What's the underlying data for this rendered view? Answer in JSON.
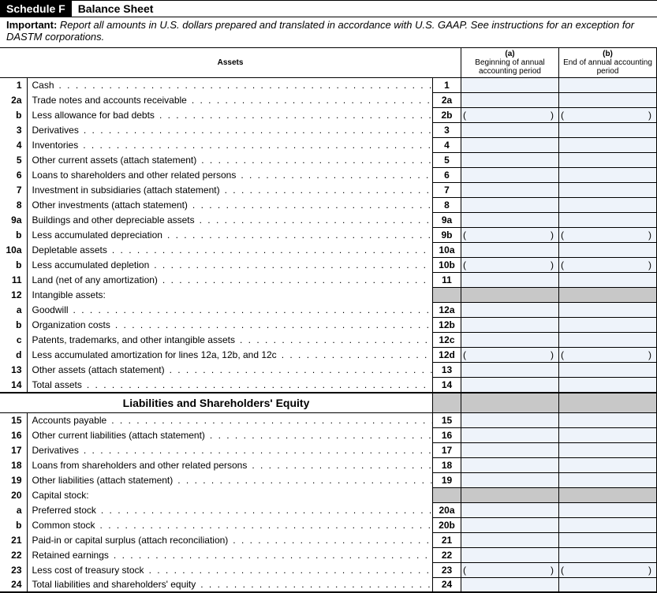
{
  "header": {
    "badge": "Schedule F",
    "title": "Balance Sheet",
    "important_label": "Important:",
    "important_text": "Report all amounts in U.S. dollars prepared and translated in accordance with U.S. GAAP. See instructions for an exception for DASTM corporations."
  },
  "sections": {
    "assets_title": "Assets",
    "liab_title": "Liabilities and Shareholders' Equity"
  },
  "col_head": {
    "a_bold": "(a)",
    "a_text": "Beginning of annual accounting period",
    "b_bold": "(b)",
    "b_text": "End of annual accounting period"
  },
  "rows": [
    {
      "num": "1",
      "desc": "Cash",
      "ln": "1",
      "a": "",
      "b": "",
      "dots": true
    },
    {
      "num": "2a",
      "desc": "Trade notes and accounts receivable",
      "ln": "2a",
      "a": "",
      "b": "",
      "dots": true
    },
    {
      "num": "b",
      "desc": "Less allowance for bad debts",
      "ln": "2b",
      "a": "paren",
      "b": "paren",
      "dots": true
    },
    {
      "num": "3",
      "desc": "Derivatives",
      "ln": "3",
      "a": "",
      "b": "",
      "dots": true
    },
    {
      "num": "4",
      "desc": "Inventories",
      "ln": "4",
      "a": "",
      "b": "",
      "dots": true
    },
    {
      "num": "5",
      "desc": "Other current assets (attach statement)",
      "ln": "5",
      "a": "",
      "b": "",
      "dots": true
    },
    {
      "num": "6",
      "desc": "Loans to shareholders and other related persons",
      "ln": "6",
      "a": "",
      "b": "",
      "dots": true
    },
    {
      "num": "7",
      "desc": "Investment in subsidiaries (attach statement)",
      "ln": "7",
      "a": "",
      "b": "",
      "dots": true
    },
    {
      "num": "8",
      "desc": "Other investments (attach statement)",
      "ln": "8",
      "a": "",
      "b": "",
      "dots": true
    },
    {
      "num": "9a",
      "desc": "Buildings and other depreciable assets",
      "ln": "9a",
      "a": "",
      "b": "",
      "dots": true
    },
    {
      "num": "b",
      "desc": "Less accumulated depreciation",
      "ln": "9b",
      "a": "paren",
      "b": "paren",
      "dots": true
    },
    {
      "num": "10a",
      "desc": "Depletable assets",
      "ln": "10a",
      "a": "",
      "b": "",
      "dots": true
    },
    {
      "num": "b",
      "desc": "Less accumulated depletion",
      "ln": "10b",
      "a": "paren",
      "b": "paren",
      "dots": true
    },
    {
      "num": "11",
      "desc": "Land (net of any amortization)",
      "ln": "11",
      "a": "",
      "b": "",
      "dots": true
    },
    {
      "num": "12",
      "desc": "Intangible assets:",
      "ln": "",
      "a": "shade",
      "b": "shade",
      "dots": false,
      "ln_shade": true
    },
    {
      "num": "a",
      "desc": "Goodwill",
      "ln": "12a",
      "a": "",
      "b": "",
      "dots": true
    },
    {
      "num": "b",
      "desc": "Organization costs",
      "ln": "12b",
      "a": "",
      "b": "",
      "dots": true
    },
    {
      "num": "c",
      "desc": "Patents, trademarks, and other intangible assets",
      "ln": "12c",
      "a": "",
      "b": "",
      "dots": true
    },
    {
      "num": "d",
      "desc": "Less accumulated amortization for lines 12a, 12b, and 12c",
      "ln": "12d",
      "a": "paren",
      "b": "paren",
      "dots": true
    },
    {
      "num": "13",
      "desc": "Other assets (attach statement)",
      "ln": "13",
      "a": "",
      "b": "",
      "dots": true
    },
    {
      "num": "14",
      "desc": "Total assets",
      "ln": "14",
      "a": "",
      "b": "",
      "dots": true,
      "thick": true
    }
  ],
  "rows2": [
    {
      "num": "15",
      "desc": "Accounts payable",
      "ln": "15",
      "a": "",
      "b": "",
      "dots": true
    },
    {
      "num": "16",
      "desc": "Other current liabilities (attach statement)",
      "ln": "16",
      "a": "",
      "b": "",
      "dots": true
    },
    {
      "num": "17",
      "desc": "Derivatives",
      "ln": "17",
      "a": "",
      "b": "",
      "dots": true
    },
    {
      "num": "18",
      "desc": "Loans from shareholders and other related persons",
      "ln": "18",
      "a": "",
      "b": "",
      "dots": true
    },
    {
      "num": "19",
      "desc": "Other liabilities (attach statement)",
      "ln": "19",
      "a": "",
      "b": "",
      "dots": true
    },
    {
      "num": "20",
      "desc": "Capital stock:",
      "ln": "",
      "a": "shade",
      "b": "shade",
      "dots": false,
      "ln_shade": true
    },
    {
      "num": "a",
      "desc": "Preferred stock",
      "ln": "20a",
      "a": "",
      "b": "",
      "dots": true
    },
    {
      "num": "b",
      "desc": "Common stock",
      "ln": "20b",
      "a": "",
      "b": "",
      "dots": true
    },
    {
      "num": "21",
      "desc": "Paid-in or capital surplus (attach reconciliation)",
      "ln": "21",
      "a": "",
      "b": "",
      "dots": true
    },
    {
      "num": "22",
      "desc": "Retained earnings",
      "ln": "22",
      "a": "",
      "b": "",
      "dots": true
    },
    {
      "num": "23",
      "desc": "Less cost of treasury stock",
      "ln": "23",
      "a": "paren",
      "b": "paren",
      "dots": true
    },
    {
      "num": "24",
      "desc": "Total liabilities and shareholders' equity",
      "ln": "24",
      "a": "",
      "b": "",
      "dots": true,
      "thick": true
    }
  ]
}
